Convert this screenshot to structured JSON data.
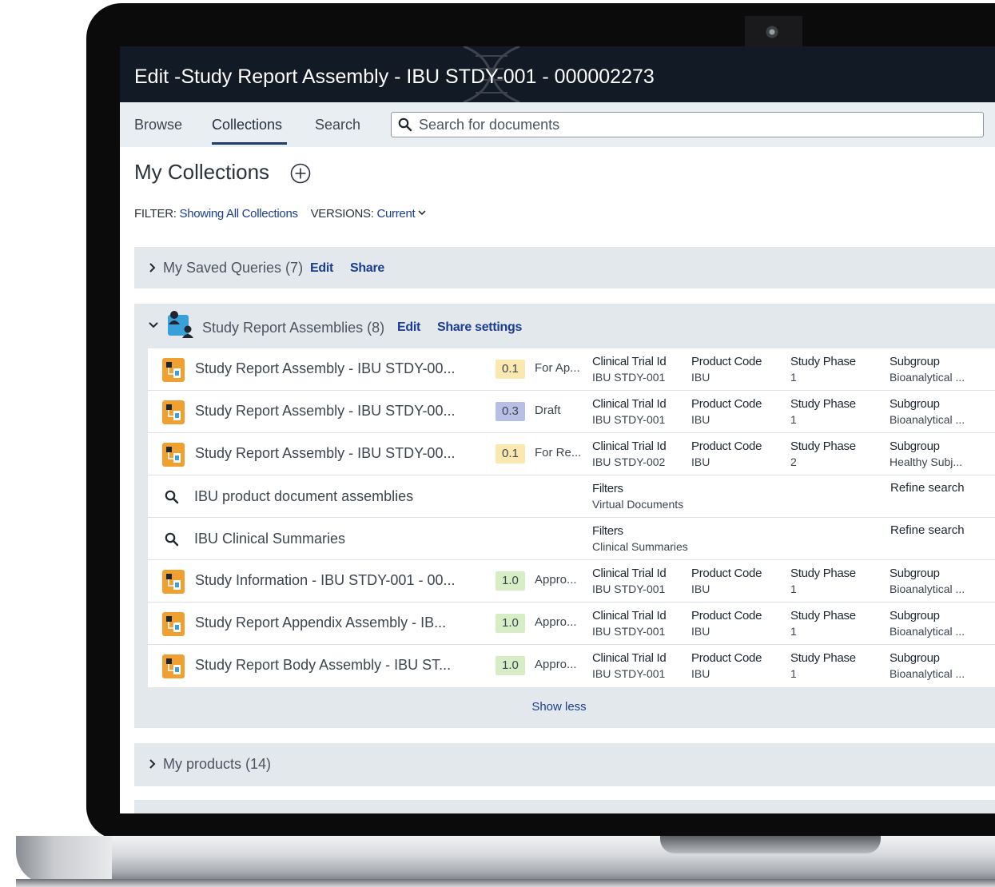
{
  "window": {
    "title": "Edit -Study Report Assembly - IBU STDY-001 - 000002273"
  },
  "nav": {
    "tabs": [
      {
        "label": "Browse"
      },
      {
        "label": "Collections",
        "active": true
      },
      {
        "label": "Search"
      }
    ],
    "search_placeholder": "Search for documents"
  },
  "page": {
    "title": "My Collections"
  },
  "filter": {
    "filter_label": "FILTER:",
    "filter_value": "Showing All Collections",
    "versions_label": "VERSIONS:",
    "versions_value": "Current"
  },
  "sections": {
    "saved_queries": {
      "label": "My Saved Queries (7)",
      "edit": "Edit",
      "share": "Share"
    },
    "study_reports": {
      "label": "Study Report Assemblies (8)",
      "edit": "Edit",
      "share": "Share settings"
    },
    "products": {
      "label": "My products (14)"
    }
  },
  "rows": [
    {
      "name": "Study Report Assembly - IBU STDY-00...",
      "version": "0.1",
      "status": "For Ap...",
      "m1h": "Clinical Trial Id",
      "m1v": "IBU STDY-001",
      "m2h": "Product Code",
      "m2v": "IBU",
      "m3h": "Study Phase",
      "m3v": "1",
      "m4h": "Subgroup",
      "m4v": "Bioanalytical ..."
    },
    {
      "name": "Study Report Assembly - IBU STDY-00...",
      "version": "0.3",
      "status": "Draft",
      "m1h": "Clinical Trial Id",
      "m1v": "IBU STDY-001",
      "m2h": "Product Code",
      "m2v": "IBU",
      "m3h": "Study Phase",
      "m3v": "1",
      "m4h": "Subgroup",
      "m4v": "Bioanalytical ..."
    },
    {
      "name": "Study Report Assembly - IBU STDY-00...",
      "version": "0.1",
      "status": "For Re...",
      "m1h": "Clinical Trial Id",
      "m1v": "IBU STDY-002",
      "m2h": "Product Code",
      "m2v": "IBU",
      "m3h": "Study Phase",
      "m3v": "2",
      "m4h": "Subgroup",
      "m4v": "Healthy Subj..."
    },
    {
      "query": "IBU product document assemblies",
      "fh": "Filters",
      "fv": "Virtual Documents",
      "refine": "Refine search"
    },
    {
      "query": "IBU Clinical Summaries",
      "fh": "Filters",
      "fv": "Clinical Summaries",
      "refine": "Refine search"
    },
    {
      "name": "Study Information - IBU STDY-001 - 00...",
      "version": "1.0",
      "status": "Appro...",
      "m1h": "Clinical Trial Id",
      "m1v": "IBU STDY-001",
      "m2h": "Product Code",
      "m2v": "IBU",
      "m3h": "Study Phase",
      "m3v": "1",
      "m4h": "Subgroup",
      "m4v": "Bioanalytical ..."
    },
    {
      "name": "Study Report Appendix Assembly - IB...",
      "version": "1.0",
      "status": "Appro...",
      "m1h": "Clinical Trial Id",
      "m1v": "IBU STDY-001",
      "m2h": "Product Code",
      "m2v": "IBU",
      "m3h": "Study Phase",
      "m3v": "1",
      "m4h": "Subgroup",
      "m4v": "Bioanalytical ..."
    },
    {
      "name": "Study Report Body Assembly - IBU ST...",
      "version": "1.0",
      "status": "Appro...",
      "m1h": "Clinical Trial Id",
      "m1v": "IBU STDY-001",
      "m2h": "Product Code",
      "m2v": "IBU",
      "m3h": "Study Phase",
      "m3v": "1",
      "m4h": "Subgroup",
      "m4v": "Bioanalytical ..."
    }
  ],
  "show_less": "Show less",
  "colors": {
    "header_bg": "#121a26",
    "nav_bg": "#e9eef3",
    "panel_bg": "#e3e8ed",
    "link": "#1a3d8f",
    "version_draft": "#b7bfe6",
    "version_review": "#fbe8b0",
    "version_approved": "#d6edc6"
  }
}
